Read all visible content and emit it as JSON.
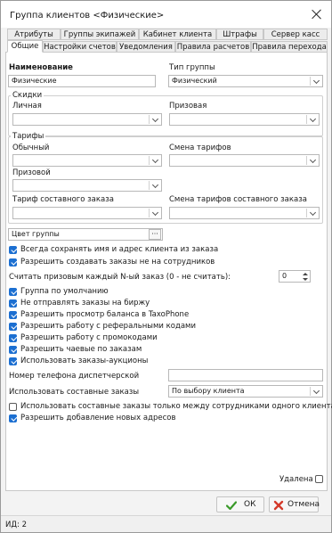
{
  "window": {
    "title": "Группа клиентов <Физические>"
  },
  "tabs": {
    "row1": [
      "Атрибуты",
      "Группы экипажей",
      "Кабинет клиента",
      "Штрафы",
      "Сервер касс"
    ],
    "row2": [
      "Общие",
      "Настройки счетов",
      "Уведомления",
      "Правила расчетов",
      "Правила перехода"
    ],
    "active": "Общие"
  },
  "general": {
    "name_label": "Наименование",
    "name_value": "Физические",
    "group_type_label": "Тип группы",
    "group_type_value": "Физический"
  },
  "discounts": {
    "title": "Скидки",
    "personal_label": "Личная",
    "personal_value": "",
    "prize_label": "Призовая",
    "prize_value": ""
  },
  "tariffs": {
    "title": "Тарифы",
    "regular_label": "Обычный",
    "regular_value": "",
    "change_label": "Смена тарифов",
    "change_value": "",
    "prize_label": "Призовой",
    "prize_value": "",
    "composite_label": "Тариф составного заказа",
    "composite_value": "",
    "composite_change_label": "Смена тарифов составного заказа",
    "composite_change_value": ""
  },
  "group_color": {
    "label": "Цвет группы",
    "dots": "···"
  },
  "checks_a": [
    {
      "label": "Всегда сохранять имя и адрес клиента из заказа",
      "checked": true
    },
    {
      "label": "Разрешить создавать заказы не на сотрудников",
      "checked": true
    }
  ],
  "prize_order": {
    "label": "Считать призовым каждый N-ый заказ (0 - не считать):",
    "value": "0"
  },
  "checks_b": [
    {
      "label": "Группа по умолчанию",
      "checked": true
    },
    {
      "label": "Не отправлять заказы на биржу",
      "checked": true
    },
    {
      "label": "Разрешить просмотр баланса в TaxoPhone",
      "checked": true
    },
    {
      "label": "Разрешить работу с реферальными кодами",
      "checked": true
    },
    {
      "label": "Разрешить работу с промокодами",
      "checked": true
    },
    {
      "label": "Разрешить чаевые по заказам",
      "checked": true
    },
    {
      "label": "Использовать заказы-аукционы",
      "checked": true
    }
  ],
  "dispatcher_phone": {
    "label": "Номер телефона диспетчерской",
    "value": ""
  },
  "composite_orders": {
    "label": "Использовать составные заказы",
    "value": "По выбору клиента"
  },
  "checks_c": [
    {
      "label": "Использовать составные заказы только между сотрудниками одного клиента",
      "checked": false
    },
    {
      "label": "Разрешить добавление новых адресов",
      "checked": true
    }
  ],
  "deleted": {
    "label": "Удалена",
    "checked": false
  },
  "buttons": {
    "ok": "ОК",
    "cancel": "Отмена"
  },
  "status": {
    "id_text": "ИД: 2"
  },
  "colors": {
    "accent": "#1c6fd1",
    "ok_icon": "#3a9a2a",
    "cancel_icon": "#d43a2a"
  }
}
